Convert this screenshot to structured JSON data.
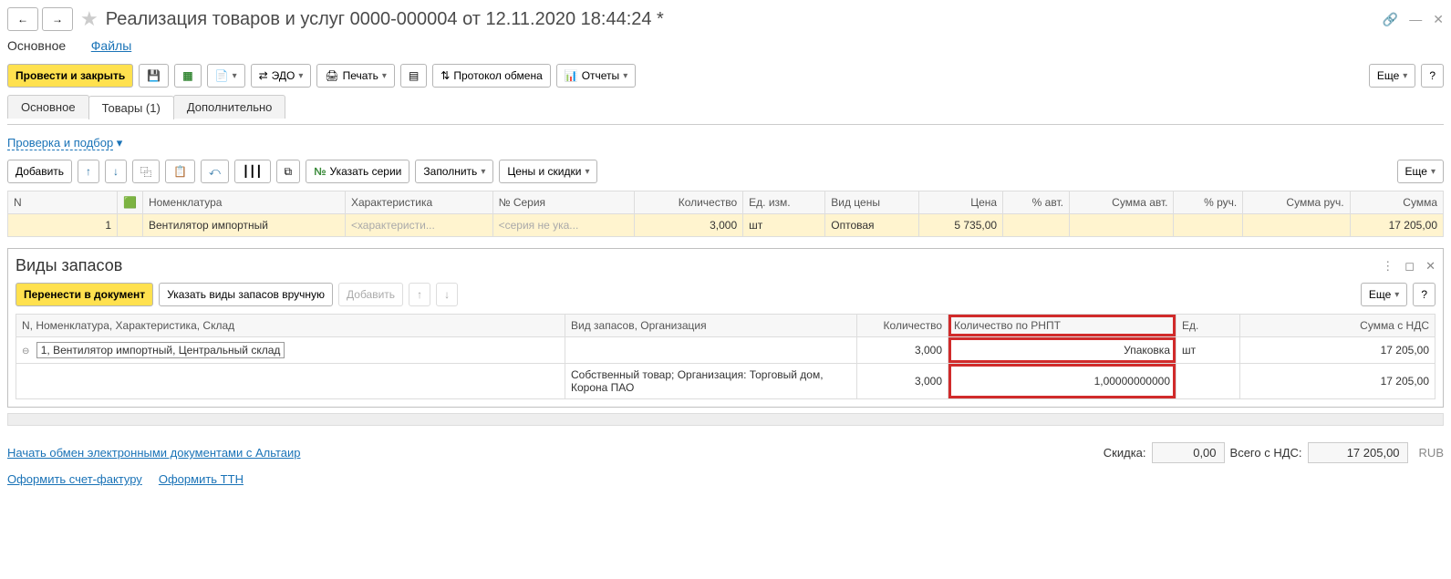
{
  "header": {
    "title": "Реализация товаров и услуг 0000-000004 от 12.11.2020 18:44:24 *"
  },
  "nav": {
    "main": "Основное",
    "files": "Файлы"
  },
  "toolbar": {
    "postAndClose": "Провести и закрыть",
    "edo": "ЭДО",
    "print": "Печать",
    "protocol": "Протокол обмена",
    "reports": "Отчеты",
    "more": "Еще",
    "help": "?"
  },
  "tabs": {
    "main": "Основное",
    "goods": "Товары (1)",
    "extra": "Дополнительно"
  },
  "checkSelect": "Проверка и подбор",
  "goodsToolbar": {
    "add": "Добавить",
    "series": "Указать серии",
    "fill": "Заполнить",
    "prices": "Цены и скидки",
    "more": "Еще"
  },
  "goodsTable": {
    "cols": {
      "n": "N",
      "nomen": "Номенклатура",
      "char": "Характеристика",
      "series": "Серия",
      "seriesPrefix": "№",
      "qty": "Количество",
      "unit": "Ед. изм.",
      "priceType": "Вид цены",
      "price": "Цена",
      "pctAuto": "% авт.",
      "sumAuto": "Сумма авт.",
      "pctMan": "% руч.",
      "sumMan": "Сумма руч.",
      "sum": "Сумма"
    },
    "row": {
      "n": "1",
      "nomen": "Вентилятор импортный",
      "char": "<характеристи...",
      "series": "<серия не ука...",
      "qty": "3,000",
      "unit": "шт",
      "priceType": "Оптовая",
      "price": "5 735,00",
      "sum": "17 205,00"
    }
  },
  "stockPanel": {
    "title": "Виды запасов",
    "transfer": "Перенести в документ",
    "manual": "Указать виды запасов вручную",
    "add": "Добавить",
    "more": "Еще",
    "help": "?",
    "cols": {
      "nnomen": "N, Номенклатура, Характеристика, Склад",
      "stockType": "Вид запасов, Организация",
      "qty": "Количество",
      "qtyRnpt": "Количество по РНПТ",
      "unit": "Ед.",
      "sumVat": "Сумма с НДС"
    },
    "r1": {
      "nomen": "1, Вентилятор импортный, Центральный склад",
      "qty": "3,000",
      "rnpt": "Упаковка",
      "unit": "шт",
      "sum": "17 205,00"
    },
    "r2": {
      "stockType": "Собственный товар; Организация: Торговый дом, Корона ПАО",
      "qty": "3,000",
      "rnpt": "1,00000000000",
      "sum": "17 205,00"
    }
  },
  "footer": {
    "startExchange": "Начать обмен электронными документами с Альтаир",
    "discount": "Скидка:",
    "discountVal": "0,00",
    "totalVat": "Всего с НДС:",
    "totalVal": "17 205,00",
    "currency": "RUB",
    "invoice": "Оформить счет-фактуру",
    "ttn": "Оформить ТТН"
  }
}
